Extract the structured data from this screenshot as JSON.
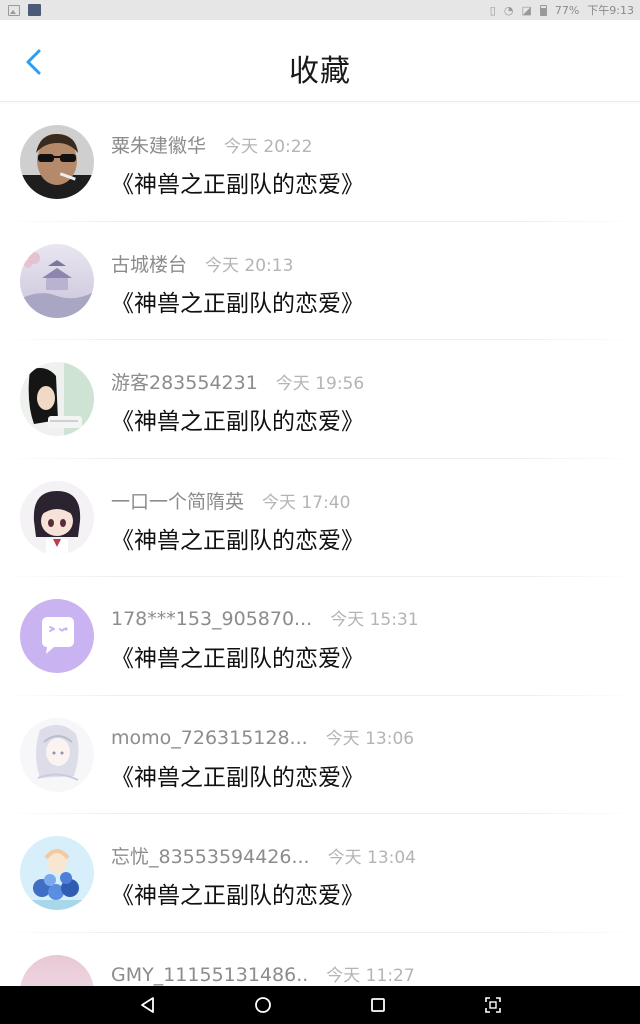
{
  "status_bar": {
    "battery_level": "77%",
    "time": "下午9:13"
  },
  "header": {
    "title": "收藏"
  },
  "favorites": [
    {
      "username": "粟朱建徽华",
      "time": "今天 20:22",
      "title": "《神兽之正副队的恋爱》",
      "avatar": "avatar-man-sunglasses"
    },
    {
      "username": "古城楼台",
      "time": "今天 20:13",
      "title": "《神兽之正副队的恋爱》",
      "avatar": "avatar-pavilion"
    },
    {
      "username": "游客283554231",
      "time": "今天 19:56",
      "title": "《神兽之正副队的恋爱》",
      "avatar": "avatar-girl-reading"
    },
    {
      "username": "一口一个简隋英",
      "time": "今天 17:40",
      "title": "《神兽之正副队的恋爱》",
      "avatar": "avatar-anime-girl"
    },
    {
      "username": "178***153_905870...",
      "time": "今天 15:31",
      "title": "《神兽之正副队的恋爱》",
      "avatar": "avatar-default-chat"
    },
    {
      "username": "momo_726315128...",
      "time": "今天 13:06",
      "title": "《神兽之正副队的恋爱》",
      "avatar": "avatar-sketch-girl"
    },
    {
      "username": "忘忧_83553594426...",
      "time": "今天 13:04",
      "title": "《神兽之正副队的恋爱》",
      "avatar": "avatar-flowers"
    },
    {
      "username": "GMY_11155131486..",
      "time": "今天 11:27",
      "title": "",
      "avatar": "avatar-pink-sky"
    }
  ],
  "colors": {
    "accent": "#2a9df4",
    "default_avatar": "#c9b3f0"
  }
}
